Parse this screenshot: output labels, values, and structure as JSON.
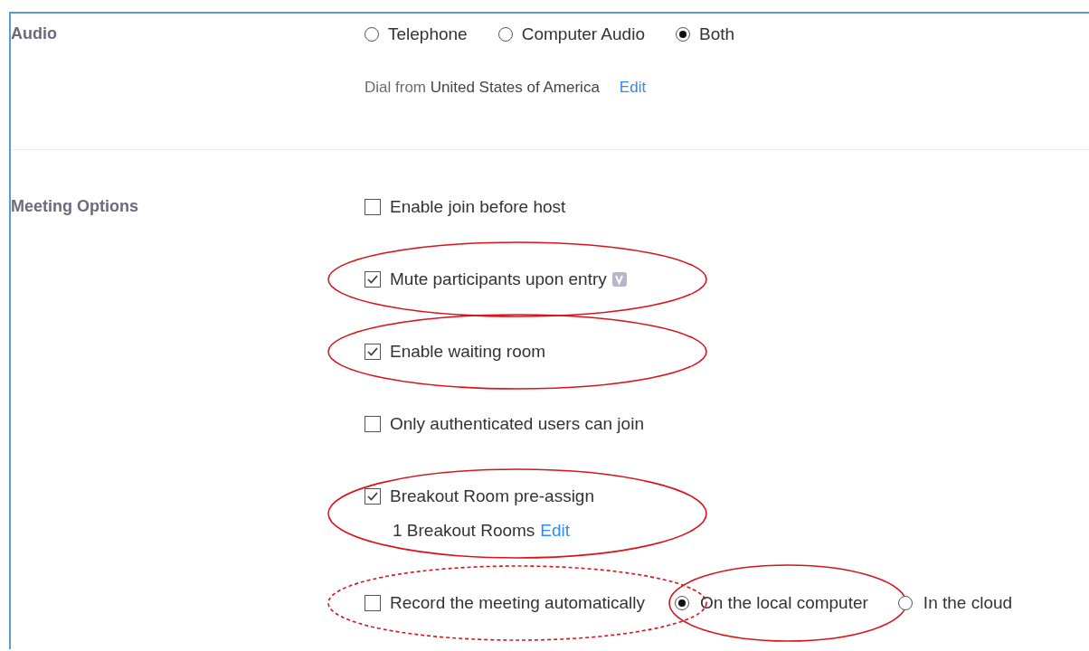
{
  "audio": {
    "label": "Audio",
    "radios": [
      {
        "label": "Telephone",
        "selected": false
      },
      {
        "label": "Computer Audio",
        "selected": false
      },
      {
        "label": "Both",
        "selected": true
      }
    ],
    "dial": {
      "prefix": "Dial from",
      "country": "United States of America",
      "link": "Edit"
    }
  },
  "meeting_options": {
    "label": "Meeting Options",
    "items": [
      {
        "label": "Enable join before host",
        "checked": false,
        "circled": false
      },
      {
        "label": "Mute participants upon entry",
        "checked": true,
        "badge": true,
        "circled": true,
        "dashed": false
      },
      {
        "label": "Enable waiting room",
        "checked": true,
        "circled": true,
        "dashed": false
      },
      {
        "label": "Only authenticated users can join",
        "checked": false,
        "circled": false
      },
      {
        "label": "Breakout Room pre-assign",
        "checked": true,
        "circled": true,
        "dashed": false,
        "sub": {
          "text": "1 Breakout Rooms",
          "link": "Edit"
        }
      },
      {
        "label": "Record the meeting automatically",
        "checked": false,
        "circled": true,
        "dashed": true,
        "choices": [
          {
            "label": "On the local computer",
            "selected": true,
            "circled": true,
            "dashed": false
          },
          {
            "label": "In the cloud",
            "selected": false,
            "circled": false
          }
        ]
      }
    ]
  }
}
